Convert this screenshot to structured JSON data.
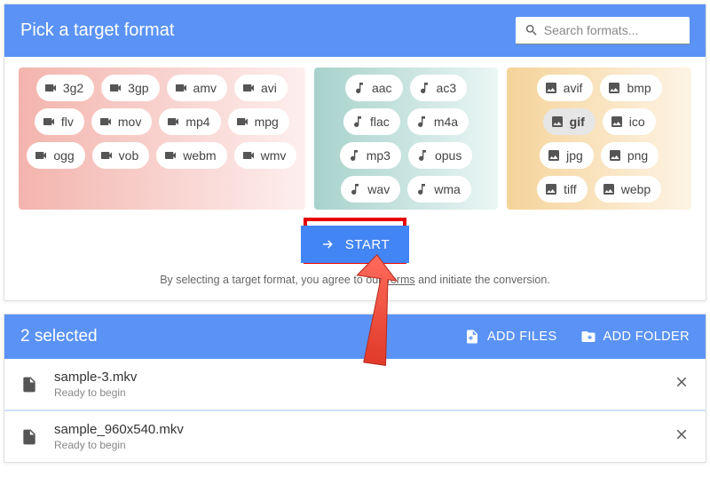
{
  "header": {
    "title": "Pick a target format",
    "search_placeholder": "Search formats..."
  },
  "groups": {
    "video": [
      "3g2",
      "3gp",
      "amv",
      "avi",
      "flv",
      "mov",
      "mp4",
      "mpg",
      "ogg",
      "vob",
      "webm",
      "wmv"
    ],
    "audio": [
      "aac",
      "ac3",
      "flac",
      "m4a",
      "mp3",
      "opus",
      "wav",
      "wma"
    ],
    "image": [
      "avif",
      "bmp",
      "gif",
      "ico",
      "jpg",
      "png",
      "tiff",
      "webp"
    ]
  },
  "selected_format": "gif",
  "start_label": "START",
  "terms": {
    "prefix": "By selecting a target format, you agree to our ",
    "link": "Terms",
    "suffix": " and initiate the conversion."
  },
  "selection": {
    "title": "2 selected",
    "add_files_label": "ADD FILES",
    "add_folder_label": "ADD FOLDER"
  },
  "files": [
    {
      "name": "sample-3.mkv",
      "status": "Ready to begin"
    },
    {
      "name": "sample_960x540.mkv",
      "status": "Ready to begin"
    }
  ],
  "colors": {
    "primary": "#5a93f5",
    "button": "#4285f4",
    "highlight": "#e80000"
  }
}
